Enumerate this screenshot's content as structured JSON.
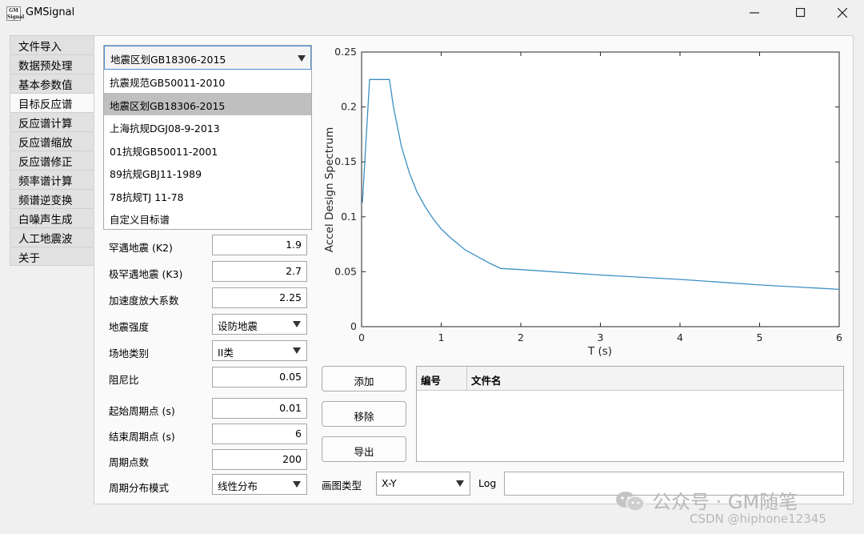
{
  "window": {
    "title": "GMSignal",
    "app_icon_text": "GM Signal"
  },
  "tabs": [
    {
      "label": "文件导入",
      "active": false
    },
    {
      "label": "数据预处理",
      "active": false
    },
    {
      "label": "基本参数值",
      "active": false
    },
    {
      "label": "目标反应谱",
      "active": true
    },
    {
      "label": "反应谱计算",
      "active": false
    },
    {
      "label": "反应谱缩放",
      "active": false
    },
    {
      "label": "反应谱修正",
      "active": false
    },
    {
      "label": "频率谱计算",
      "active": false
    },
    {
      "label": "频谱逆变换",
      "active": false
    },
    {
      "label": "白噪声生成",
      "active": false
    },
    {
      "label": "人工地震波",
      "active": false
    },
    {
      "label": "关于",
      "active": false
    }
  ],
  "spectrum_select": {
    "value": "地震区划GB18306-2015",
    "options": [
      "抗震规范GB50011-2010",
      "地震区划GB18306-2015",
      "上海抗规DGJ08-9-2013",
      "01抗规GB50011-2001",
      "89抗规GBJ11-1989",
      "78抗规TJ 11-78",
      "自定义目标谱"
    ],
    "selected_index": 1
  },
  "params": {
    "k2": {
      "label": "罕遇地震 (K2)",
      "value": "1.9"
    },
    "k3": {
      "label": "极罕遇地震 (K3)",
      "value": "2.7"
    },
    "amp": {
      "label": "加速度放大系数",
      "value": "2.25"
    },
    "intensity": {
      "label": "地震强度",
      "value": "设防地震"
    },
    "site": {
      "label": "场地类别",
      "value": "II类"
    },
    "damping": {
      "label": "阻尼比",
      "value": "0.05"
    }
  },
  "period": {
    "start": {
      "label": "起始周期点 (s)",
      "value": "0.01"
    },
    "end": {
      "label": "结束周期点 (s)",
      "value": "6"
    },
    "count": {
      "label": "周期点数",
      "value": "200"
    },
    "mode": {
      "label": "周期分布模式",
      "value": "线性分布"
    }
  },
  "buttons": {
    "add": "添加",
    "remove": "移除",
    "export": "导出"
  },
  "file_table": {
    "columns": [
      "编号",
      "文件名"
    ],
    "rows": []
  },
  "plot_type": {
    "label": "画图类型",
    "value": "X-Y"
  },
  "log": {
    "label": "Log",
    "value": ""
  },
  "watermark": {
    "text": "公众号 · GM随笔",
    "csdn": "CSDN @hiphone12345"
  },
  "colors": {
    "series": "#3b8fc4",
    "accent": "#4a90d9",
    "selected": "#bfbfbf"
  },
  "chart_data": {
    "type": "line",
    "title": "",
    "xlabel": "T (s)",
    "ylabel": "Accel Design Spectrum",
    "xlim": [
      0,
      6
    ],
    "ylim": [
      0,
      0.25
    ],
    "xticks": [
      0,
      1,
      2,
      3,
      4,
      5,
      6
    ],
    "yticks": [
      0,
      0.05,
      0.1,
      0.15,
      0.2,
      0.25
    ],
    "grid": false,
    "series": [
      {
        "x": [
          0.01,
          0.1,
          0.35,
          0.4,
          0.5,
          0.6,
          0.7,
          0.8,
          0.9,
          1.0,
          1.1,
          1.2,
          1.3,
          1.4,
          1.5,
          1.6,
          1.75,
          2.0,
          3.0,
          4.0,
          5.0,
          6.0
        ],
        "y": [
          0.113,
          0.225,
          0.225,
          0.2,
          0.164,
          0.14,
          0.122,
          0.109,
          0.098,
          0.089,
          0.082,
          0.076,
          0.07,
          0.066,
          0.062,
          0.058,
          0.053,
          0.052,
          0.047,
          0.043,
          0.038,
          0.034
        ]
      }
    ]
  }
}
